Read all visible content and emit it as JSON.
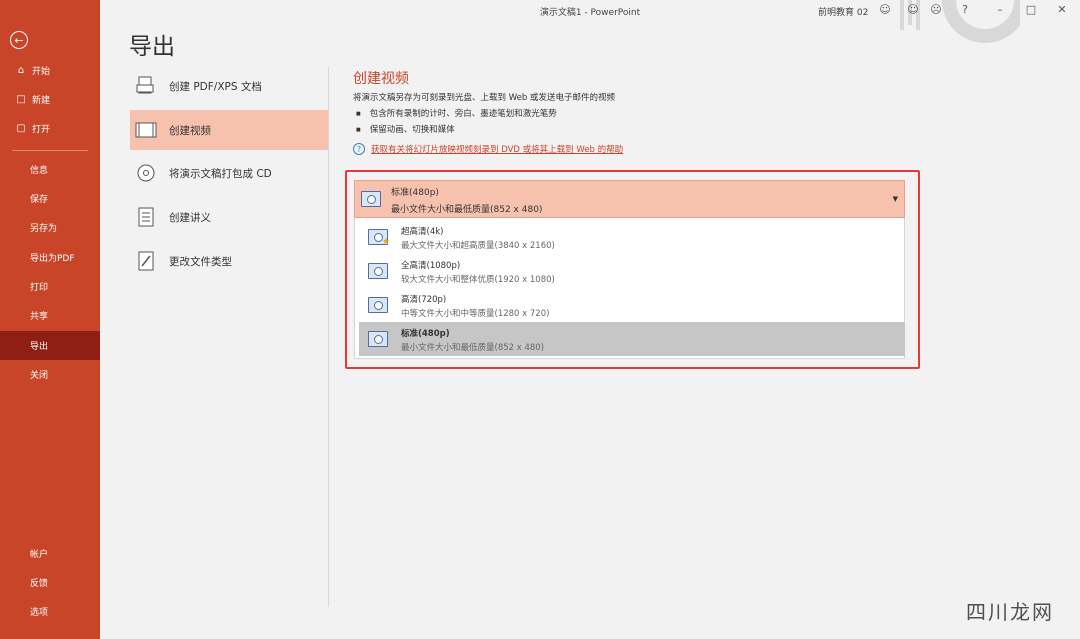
{
  "window": {
    "title": "演示文稿1  -  PowerPoint",
    "user": "前明教育 02"
  },
  "sidebar": {
    "back_icon": "back-arrow-icon",
    "items": [
      {
        "label": "开始",
        "icon": "home-icon"
      },
      {
        "label": "新建",
        "icon": "new-file-icon"
      },
      {
        "label": "打开",
        "icon": "folder-open-icon"
      },
      {
        "label": "信息"
      },
      {
        "label": "保存"
      },
      {
        "label": "另存为"
      },
      {
        "label": "导出为PDF"
      },
      {
        "label": "打印"
      },
      {
        "label": "共享"
      },
      {
        "label": "导出",
        "active": true
      },
      {
        "label": "关闭"
      },
      {
        "label": "帐户"
      },
      {
        "label": "反馈"
      },
      {
        "label": "选项"
      }
    ],
    "accent": "#c8452a",
    "active_color": "#8f1f12"
  },
  "page": {
    "title": "导出"
  },
  "export_options": [
    {
      "label": "创建 PDF/XPS 文档",
      "icon": "pdf-doc-icon"
    },
    {
      "label": "创建视频",
      "icon": "video-icon",
      "selected": true
    },
    {
      "label": "将演示文稿打包成 CD",
      "icon": "cd-package-icon"
    },
    {
      "label": "创建讲义",
      "icon": "handout-icon"
    },
    {
      "label": "更改文件类型",
      "icon": "change-filetype-icon"
    }
  ],
  "pane": {
    "title": "创建视频",
    "description": "将演示文稿另存为可刻录到光盘、上载到 Web 或发送电子邮件的视频",
    "bullets": [
      "包含所有录制的计时、旁白、墨迹笔划和激光笔势",
      "保留动画、切换和媒体"
    ],
    "help_link": "获取有关将幻灯片放映视频刻录到 DVD 或将其上载到 Web 的帮助"
  },
  "quality_dropdown": {
    "selected": {
      "name": "标准(480p)",
      "desc": "最小文件大小和最低质量(852 x 480)"
    },
    "options": [
      {
        "name": "超高清(4k)",
        "desc": "最大文件大小和超高质量(3840 x 2160)",
        "icon": "video-4k-icon"
      },
      {
        "name": "全高清(1080p)",
        "desc": "较大文件大小和整体优质(1920 x 1080)",
        "icon": "video-1080p-icon"
      },
      {
        "name": "高清(720p)",
        "desc": "中等文件大小和中等质量(1280 x 720)",
        "icon": "video-720p-icon"
      },
      {
        "name": "标准(480p)",
        "desc": "最小文件大小和最低质量(852 x 480)",
        "icon": "video-480p-icon",
        "selected": true
      }
    ],
    "highlight_color": "#e8393a"
  },
  "watermark": "四川龙网"
}
